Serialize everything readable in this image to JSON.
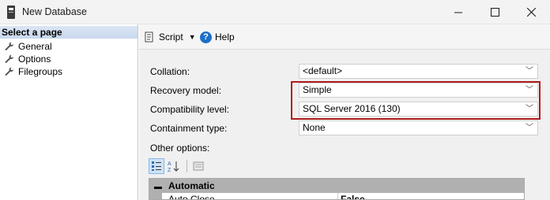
{
  "window": {
    "title": "New Database",
    "icon": "database-icon",
    "controls": [
      "minimize-icon",
      "maximize-icon",
      "close-icon"
    ]
  },
  "left_pane": {
    "header": "Select a page",
    "items": [
      {
        "label": "General",
        "icon": "wrench-icon"
      },
      {
        "label": "Options",
        "icon": "wrench-icon"
      },
      {
        "label": "Filegroups",
        "icon": "wrench-icon"
      }
    ]
  },
  "toolbar": {
    "script_label": "Script",
    "help_label": "Help"
  },
  "form": {
    "collation": {
      "label": "Collation:",
      "value": "<default>"
    },
    "recovery_model": {
      "label": "Recovery model:",
      "value": "Simple"
    },
    "compatibility_level": {
      "label": "Compatibility level:",
      "value": "SQL Server 2016 (130)"
    },
    "containment_type": {
      "label": "Containment type:",
      "value": "None"
    }
  },
  "other_options": {
    "label": "Other options:",
    "category": "Automatic",
    "properties": [
      {
        "name": "Auto Close",
        "value": "False"
      }
    ]
  },
  "colors": {
    "highlight_border": "#b01c1c",
    "help_icon": "#1d6fc9",
    "header_bg": "#c9d8ee"
  }
}
